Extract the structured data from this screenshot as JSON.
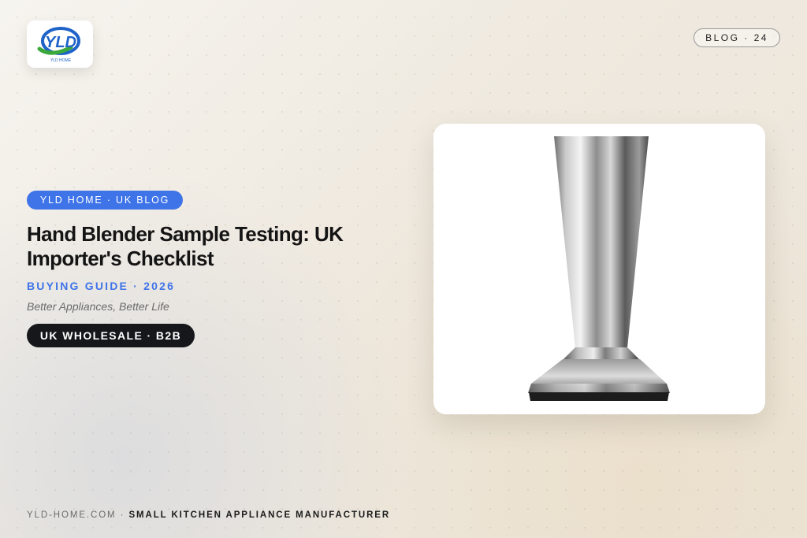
{
  "logo": {
    "letters": "YLD",
    "subtext": "YLD HOME"
  },
  "header": {
    "blog_pill": "BLOG · 24"
  },
  "hero": {
    "brand_badge": "YLD HOME · UK BLOG",
    "title": "Hand Blender Sample Testing: UK Importer's Checklist",
    "subtitle": "BUYING GUIDE · 2026",
    "tagline": "Better Appliances, Better Life",
    "wholesale_pill": "UK WHOLESALE · B2B"
  },
  "product": {
    "image_icon": "hand-blender-shaft-icon"
  },
  "footer": {
    "site": "YLD-HOME.COM",
    "separator": " · ",
    "description": "SMALL KITCHEN APPLIANCE MANUFACTURER"
  },
  "colors": {
    "accent_blue": "#3f74e9",
    "dark_pill": "#15171b",
    "logo_green": "#3aa83a",
    "logo_blue": "#1f63c9"
  }
}
